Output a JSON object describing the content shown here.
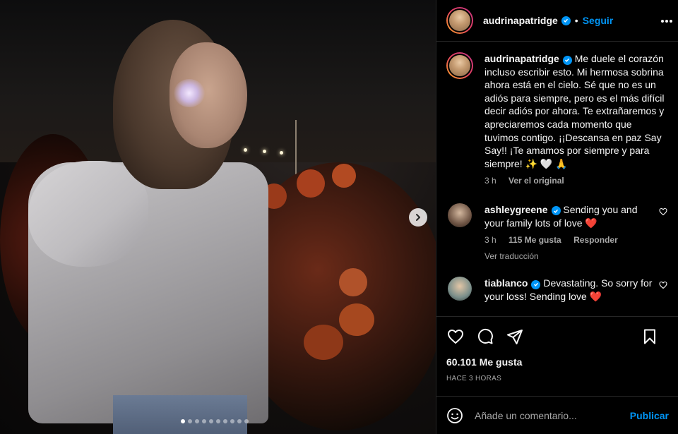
{
  "post": {
    "author": "audrinapatridge",
    "follow_label": "Seguir",
    "separator": "•",
    "caption": "Me duele el corazón incluso escribir esto. Mi hermosa sobrina ahora está en el cielo. Sé que no es un adiós para siempre, pero es el más difícil decir adiós por ahora. Te extrañaremos y apreciaremos cada momento que tuvimos contigo. ¡¡Descansa en paz Say Say!! ¡Te amamos por siempre y para siempre! ✨ 🤍 🙏",
    "caption_time": "3 h",
    "see_original": "Ver el original"
  },
  "comments": [
    {
      "user": "ashleygreene",
      "text": "Sending you and your family lots of love",
      "emoji": "❤️",
      "time": "3 h",
      "likes": "115 Me gusta",
      "reply": "Responder",
      "translate": "Ver traducción"
    },
    {
      "user": "tiablanco",
      "text": "Devastating. So sorry for your loss! Sending love",
      "emoji": "❤️"
    }
  ],
  "footer": {
    "likes_count": "60.101 Me gusta",
    "timestamp": "HACE 3 HORAS",
    "comment_placeholder": "Añade un comentario...",
    "publish_label": "Publicar"
  },
  "carousel": {
    "total": 10,
    "active_index": 0
  },
  "colors": {
    "accent": "#0095f6",
    "background": "#000000",
    "divider": "#262626",
    "muted": "#a8a8a8",
    "like_red": "#ed4956"
  }
}
